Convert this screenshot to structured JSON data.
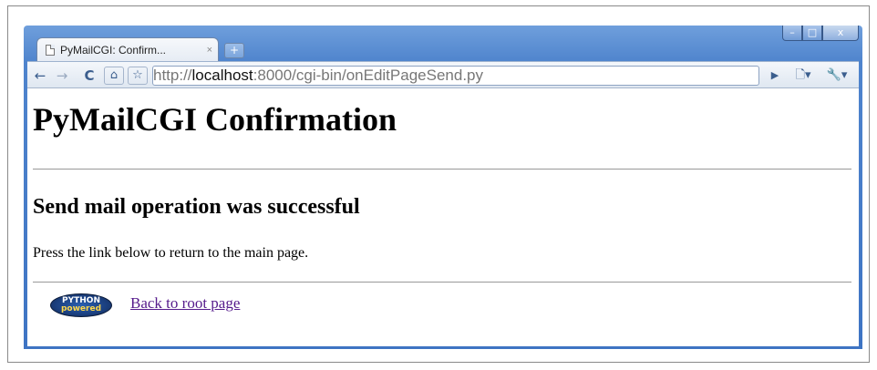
{
  "browser": {
    "tab_title": "PyMailCGI: Confirm...",
    "tab_close": "×",
    "new_tab": "+",
    "url_host": "localhost",
    "url_prefix": "http://",
    "url_suffix": ":8000/cgi-bin/onEditPageSend.py",
    "icons": {
      "back": "back-arrow-icon",
      "forward": "forward-arrow-icon",
      "reload": "reload-icon",
      "home": "home-icon",
      "star": "star-icon",
      "go": "play-icon",
      "page_menu": "page-menu-icon",
      "tools_menu": "wrench-icon"
    },
    "accent": "#4f84cd"
  },
  "page": {
    "heading": "PyMailCGI Confirmation",
    "subheading": "Send mail operation was successful",
    "message": "Press the link below to return to the main page.",
    "link": "Back to root page",
    "link_color": "#551a8b",
    "logo_text_top": "PYTHON",
    "logo_text_bottom": "powered"
  }
}
